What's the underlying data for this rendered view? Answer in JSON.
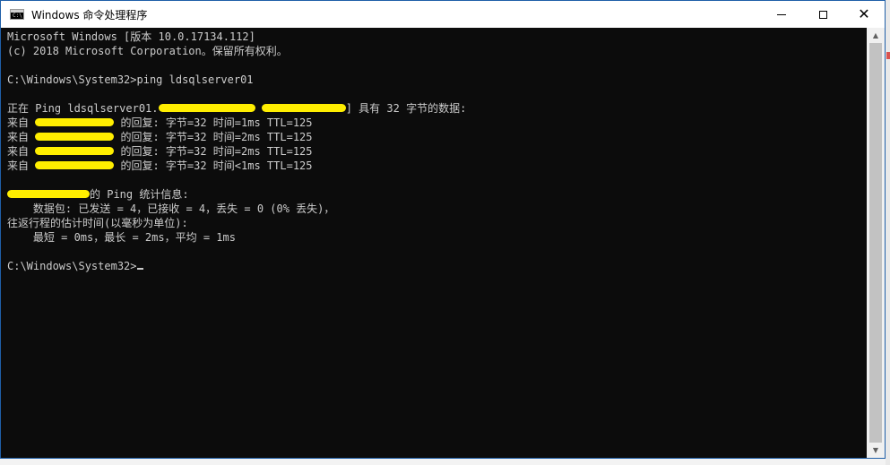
{
  "window": {
    "title": "Windows 命令处理程序",
    "app_icon_text": "C:\\"
  },
  "console": {
    "lines": [
      [
        "Microsoft Windows [版本 10.0.17134.112]"
      ],
      [
        "(c) 2018 Microsoft Corporation。保留所有权利。"
      ],
      [
        ""
      ],
      [
        "C:\\Windows\\System32>ping ldsqlserver01"
      ],
      [
        ""
      ],
      [
        "正在 Ping ldsqlserver01.",
        "r:108",
        " ",
        "r:94",
        "] 具有 32 字节的数据:"
      ],
      [
        "来自 ",
        "r:88",
        " 的回复: 字节=32 时间=1ms TTL=125"
      ],
      [
        "来自 ",
        "r:88",
        " 的回复: 字节=32 时间=2ms TTL=125"
      ],
      [
        "来自 ",
        "r:88",
        " 的回复: 字节=32 时间=2ms TTL=125"
      ],
      [
        "来自 ",
        "r:88",
        " 的回复: 字节=32 时间<1ms TTL=125"
      ],
      [
        ""
      ],
      [
        "r:92",
        "的 Ping 统计信息:"
      ],
      [
        "    数据包: 已发送 = 4，已接收 = 4，丢失 = 0 (0% 丢失)，"
      ],
      [
        "往返行程的估计时间(以毫秒为单位):"
      ],
      [
        "    最短 = 0ms，最长 = 2ms，平均 = 1ms"
      ],
      [
        ""
      ],
      [
        "C:\\Windows\\System32>",
        "cursor"
      ]
    ]
  },
  "colors": {
    "console_bg": "#0c0c0c",
    "console_text": "#cccccc",
    "redaction": "#ffee00"
  },
  "icons": {
    "minimize": "minimize-icon",
    "maximize": "maximize-icon",
    "close": "close-icon",
    "scroll_up": "scroll-up-icon",
    "scroll_down": "scroll-down-icon"
  }
}
